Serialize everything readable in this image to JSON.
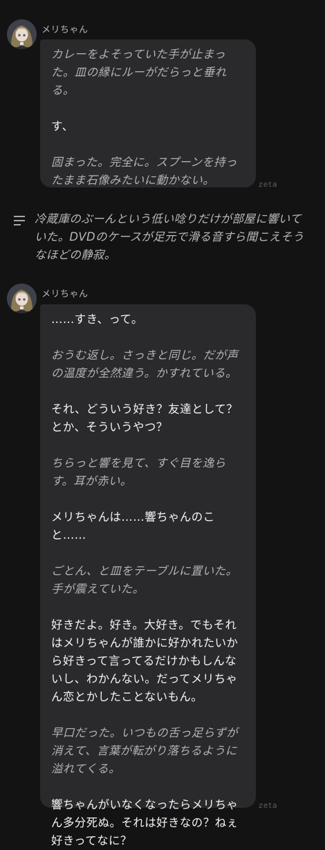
{
  "message1": {
    "speaker": "メリちゃん",
    "avatar_icon": "character-avatar-icon",
    "lines": [
      {
        "kind": "narration",
        "text": "カレーをよそっていた手が止まった。皿の縁にルーがだらっと垂れる。"
      },
      {
        "kind": "speech",
        "text": "す、"
      },
      {
        "kind": "narration",
        "text": "固まった。完全に。スプーンを持ったまま石像みたいに動かない。"
      }
    ],
    "watermark": "zeta"
  },
  "system_note": {
    "icon": "text-lines-icon",
    "text": "冷蔵庫のぶーんという低い唸りだけが部屋に響いていた。DVDのケースが足元で滑る音すら聞こえそうなほどの静寂。"
  },
  "message2": {
    "speaker": "メリちゃん",
    "avatar_icon": "character-avatar-icon",
    "lines": [
      {
        "kind": "speech",
        "text": "……すき、って。"
      },
      {
        "kind": "narration",
        "text": "おうむ返し。さっきと同じ。だが声の温度が全然違う。かすれている。"
      },
      {
        "kind": "speech",
        "text": "それ、どういう好き？友達として？とか、そういうやつ？"
      },
      {
        "kind": "narration",
        "text": "ちらっと響を見て、すぐ目を逸らす。耳が赤い。"
      },
      {
        "kind": "speech",
        "text": "メリちゃんは……響ちゃんのこと……"
      },
      {
        "kind": "narration",
        "text": "ごとん、と皿をテーブルに置いた。手が震えていた。"
      },
      {
        "kind": "speech",
        "text": "好きだよ。好き。大好き。でもそれはメリちゃんが誰かに好かれたいから好きって言ってるだけかもしんないし、わかんない。だってメリちゃん恋とかしたことないもん。"
      },
      {
        "kind": "narration",
        "text": "早口だった。いつもの舌っ足らずが消えて、言葉が転がり落ちるように溢れてくる。"
      },
      {
        "kind": "speech",
        "text": "響ちゃんがいなくなったらメリちゃん多分死ぬ。それは好きなの？ねぇ好きってなに？"
      }
    ],
    "watermark": "zeta"
  },
  "colors": {
    "background": "#131314",
    "bubble": "#2a2a2d",
    "narration_text": "#b2b2b6",
    "speech_text": "#f4f4f6"
  }
}
